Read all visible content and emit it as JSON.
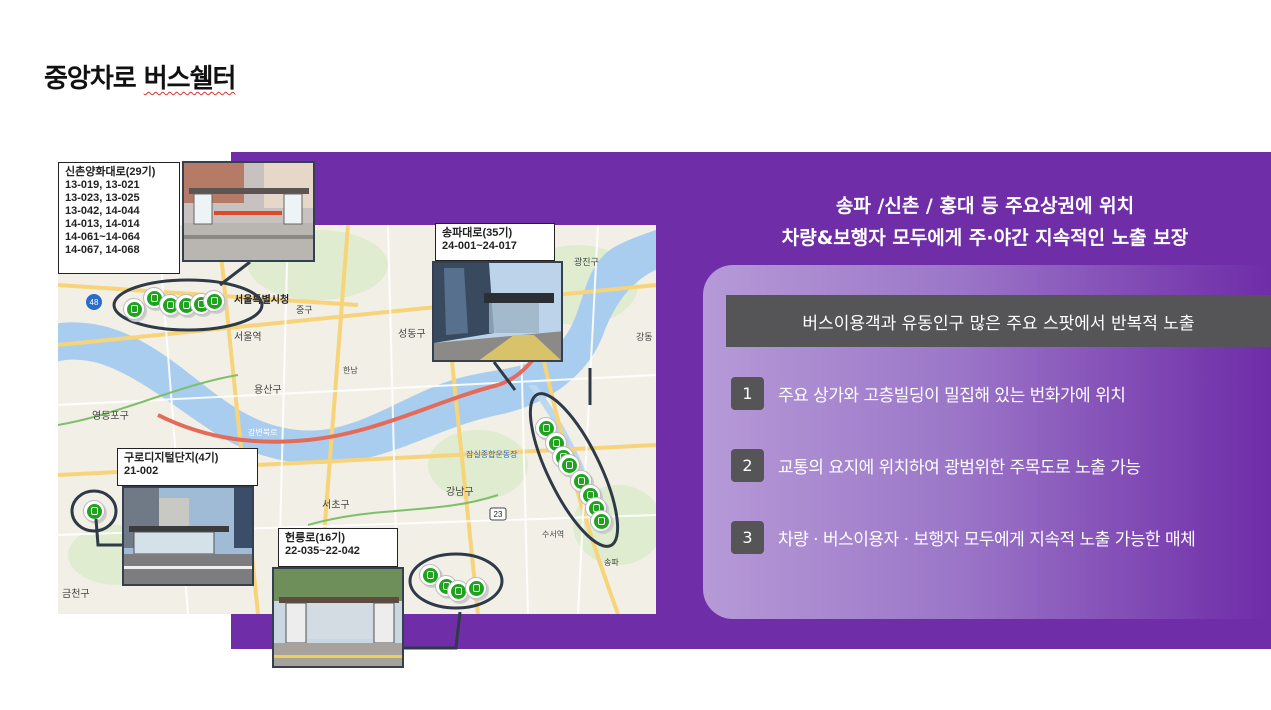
{
  "title": {
    "prefix": "중앙차로 ",
    "suffix": "버스쉘터"
  },
  "headline": {
    "line1": "송파 /신촌 / 홍대 등 주요상권에 위치",
    "line2": "차량&보행자 모두에게 주·야간 지속적인 노출 보장"
  },
  "banner": "버스이용객과 유동인구 많은 주요 스팟에서 반복적 노출",
  "points": [
    {
      "num": "1",
      "text": "주요 상가와 고층빌딩이 밀집해 있는 번화가에 위치"
    },
    {
      "num": "2",
      "text": "교통의 요지에 위치하여 광범위한 주목도로 노출 가능"
    },
    {
      "num": "3",
      "text": "차량 · 버스이용자 · 보행자 모두에게 지속적 노출 가능한 매체"
    }
  ],
  "locations": {
    "sinchon": {
      "name": "신촌양화대로(29기)",
      "codes": [
        "13-019, 13-021",
        "13-023, 13-025",
        "13-042, 14-044",
        "14-013, 14-014",
        "14-061~14-064",
        "14-067, 14-068"
      ]
    },
    "songpa": {
      "name": "송파대로(35기)",
      "codes": [
        "24-001~24-017"
      ]
    },
    "guro": {
      "name": "구로디지털단지(4기)",
      "codes": [
        "21-002"
      ]
    },
    "heolleung": {
      "name": "헌릉로(16기)",
      "codes": [
        "22-035~22-042"
      ]
    }
  },
  "map_labels": {
    "seoul_city_hall": "서울특별시청",
    "yongsan": "용산구",
    "seoul_station": "서울역",
    "gangnam": "강남구",
    "seocho": "서초구",
    "geumcheon": "금천구",
    "yeongdeungpo": "영등포구",
    "seongdong": "성동구",
    "jamsil": "잠실종합운동장",
    "songpa": "송파",
    "suseo": "수서역",
    "gangdong": "강동",
    "gwangjin": "광진구",
    "junggu": "중구",
    "hannam": "한남",
    "hangang": "강변북로",
    "route48": "48",
    "route23": "23"
  },
  "colors": {
    "panel": "#6f2da8",
    "banner": "#555456",
    "bus_marker": "#1fa31f"
  }
}
